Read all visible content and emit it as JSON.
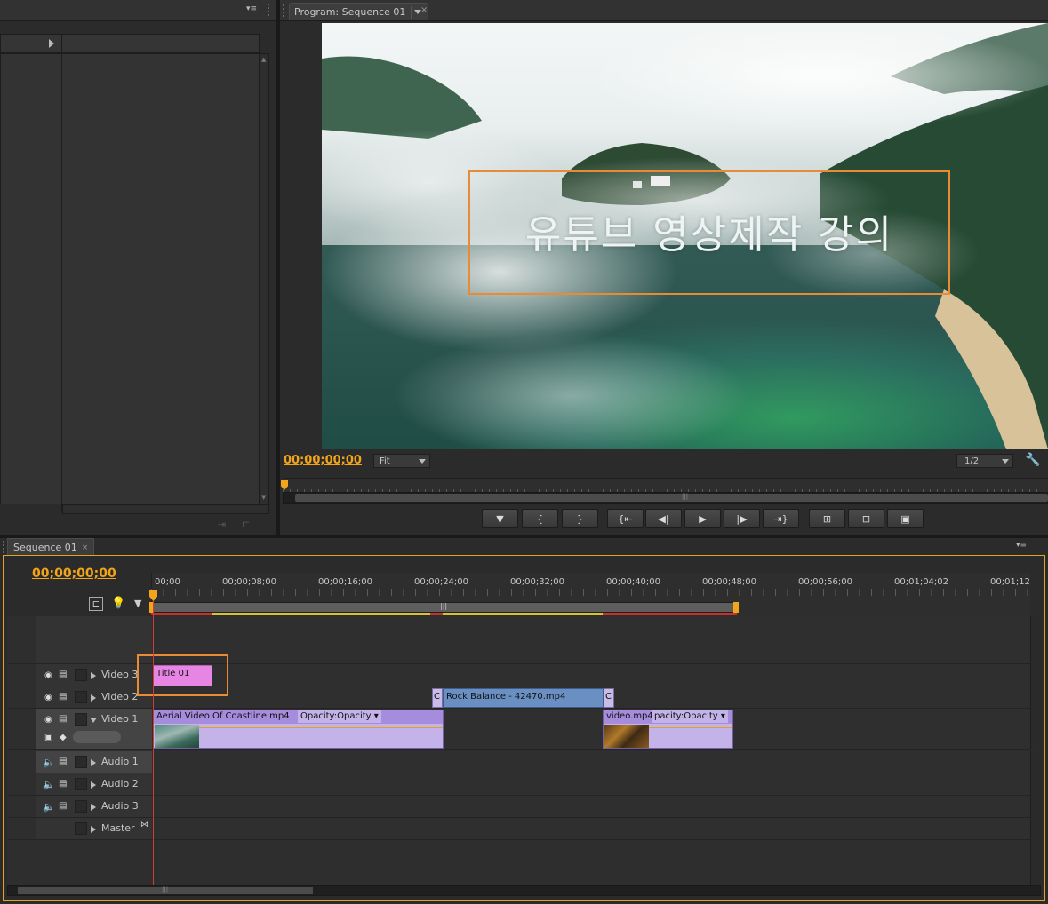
{
  "program_monitor": {
    "tab_title": "Program: Sequence 01",
    "title_overlay": "유튜브 영상제작 강의",
    "timecode": "00;00;00;00",
    "zoom_select": "Fit",
    "resolution_select": "1/2"
  },
  "transport": {
    "buttons": [
      "add-marker",
      "mark-in",
      "mark-out",
      "go-to-in",
      "step-back",
      "play",
      "step-forward",
      "go-to-out",
      "lift",
      "extract",
      "export-frame"
    ]
  },
  "timeline": {
    "tab_title": "Sequence 01",
    "timecode": "00;00;00;00",
    "ruler_labels": [
      "00;00",
      "00;00;08;00",
      "00;00;16;00",
      "00;00;24;00",
      "00;00;32;00",
      "00;00;40;00",
      "00;00;48;00",
      "00;00;56;00",
      "00;01;04;02",
      "00;01;12"
    ],
    "video_tracks": [
      "Video 3",
      "Video 2",
      "Video 1"
    ],
    "audio_tracks": [
      "Audio 1",
      "Audio 2",
      "Audio 3"
    ],
    "master_track": "Master",
    "clips": {
      "title": "Title 01",
      "rock": "Rock Balance - 42470.mp4",
      "transition_a": "C",
      "transition_b": "C",
      "aerial": "Aerial Video Of Coastline.mp4",
      "aerial_opacity": "Opacity:Opacity ▾",
      "video": "video.mp4",
      "video_opacity": "pacity:Opacity ▾"
    }
  },
  "colors": {
    "timecode": "#f2a41a",
    "title_clip": "#e685e4",
    "video_clip": "#c3b3e8",
    "rock_clip": "#6a8fc3",
    "highlight": "#e98a35"
  }
}
